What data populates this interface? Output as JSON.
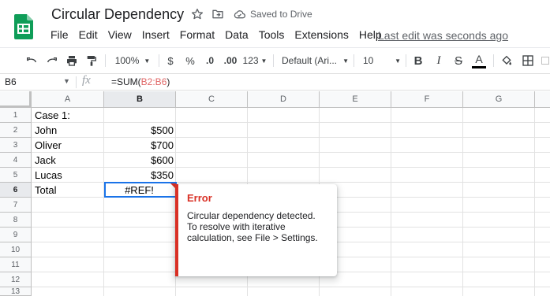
{
  "document": {
    "title": "Circular Dependency",
    "saved_status": "Saved to Drive",
    "last_edit": "Last edit was seconds ago"
  },
  "menu": [
    "File",
    "Edit",
    "View",
    "Insert",
    "Format",
    "Data",
    "Tools",
    "Extensions",
    "Help"
  ],
  "toolbar": {
    "zoom": "100%",
    "currency": "$",
    "percent": "%",
    "decrease_decimals": ".0",
    "increase_decimals": ".00",
    "more_formats": "123",
    "font_family": "Default (Ari...",
    "font_size": "10",
    "bold": "B",
    "italic": "I",
    "strikethrough": "S",
    "text_color": "A"
  },
  "formula_bar": {
    "cell_ref": "B6",
    "fx": "fx",
    "formula_prefix": "=SUM(",
    "formula_range": "B2:B6",
    "formula_suffix": ")"
  },
  "columns": [
    "A",
    "B",
    "C",
    "D",
    "E",
    "F",
    "G"
  ],
  "rows": [
    "1",
    "2",
    "3",
    "4",
    "5",
    "6",
    "7",
    "8",
    "9",
    "10",
    "11",
    "12",
    "13"
  ],
  "cells": {
    "A1": "Case 1:",
    "A2": "John",
    "B2": "$500",
    "A3": "Oliver",
    "B3": "$700",
    "A4": "Jack",
    "B4": "$600",
    "A5": "Lucas",
    "B5": "$350",
    "A6": "Total",
    "B6": "#REF!"
  },
  "error_popup": {
    "title": "Error",
    "lines": [
      "Circular dependency detected.",
      "To resolve with iterative",
      "calculation, see File > Settings."
    ]
  },
  "colors": {
    "brand_green": "#0f9d58",
    "selection_blue": "#1a73e8",
    "error_red": "#d93025"
  }
}
